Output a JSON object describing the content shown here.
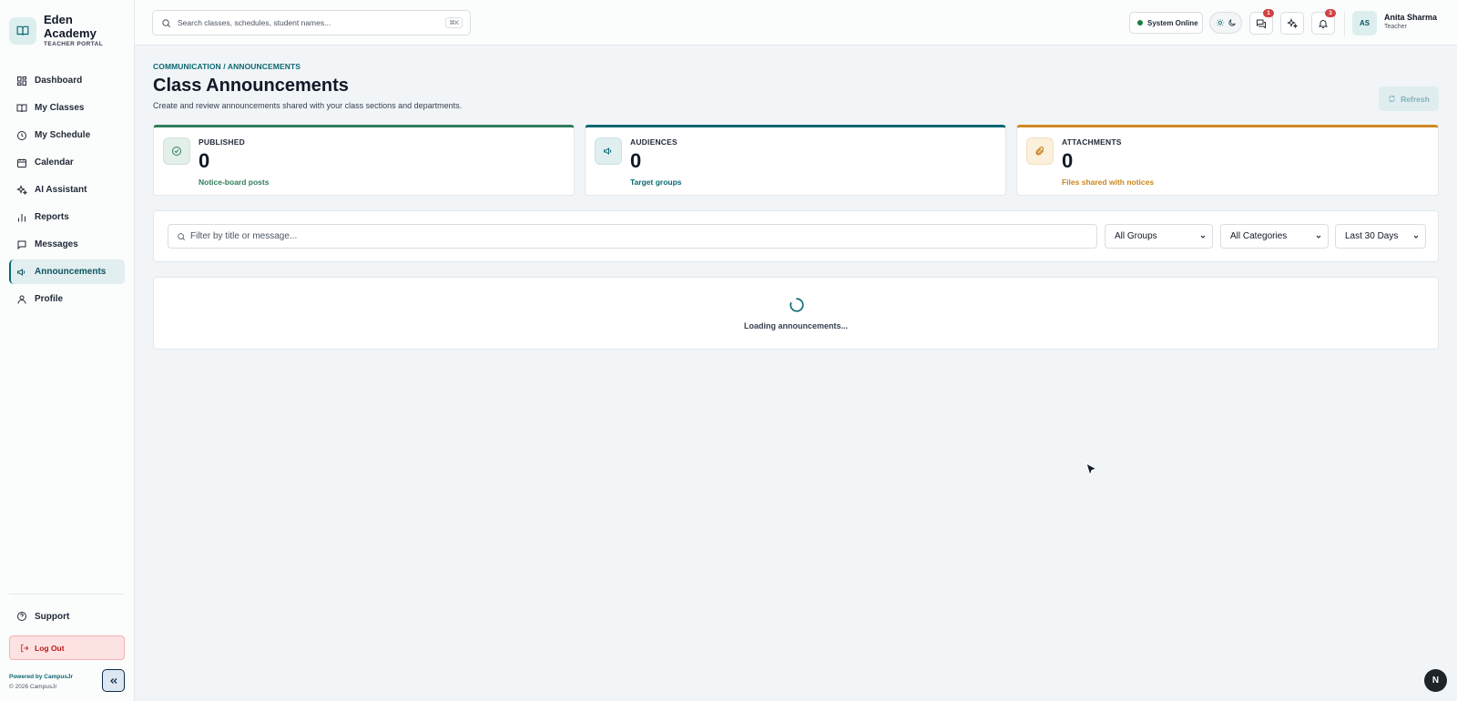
{
  "brand": {
    "name": "Eden Academy",
    "subtitle": "TEACHER PORTAL"
  },
  "sidebar": {
    "items": [
      {
        "label": "Dashboard",
        "icon": "dashboard-icon"
      },
      {
        "label": "My Classes",
        "icon": "book-icon"
      },
      {
        "label": "My Schedule",
        "icon": "clock-icon"
      },
      {
        "label": "Calendar",
        "icon": "calendar-icon"
      },
      {
        "label": "AI Assistant",
        "icon": "sparkles-icon"
      },
      {
        "label": "Reports",
        "icon": "bar-chart-icon"
      },
      {
        "label": "Messages",
        "icon": "message-icon"
      },
      {
        "label": "Announcements",
        "icon": "megaphone-icon",
        "active": true
      },
      {
        "label": "Profile",
        "icon": "user-icon"
      }
    ],
    "support_label": "Support",
    "logout_label": "Log Out",
    "powered_by": "Powered by CampusJr",
    "copyright": "© 2026 CampusJr"
  },
  "topbar": {
    "search_placeholder": "Search classes, schedules, student names...",
    "search_shortcut": "⌘K",
    "status": "System Online",
    "messages_badge": "1",
    "notifications_badge": "3",
    "user": {
      "initials": "AS",
      "name": "Anita Sharma",
      "role": "Teacher"
    }
  },
  "page": {
    "breadcrumb": "COMMUNICATION / ANNOUNCEMENTS",
    "title": "Class Announcements",
    "description": "Create and review announcements shared with your class sections and departments.",
    "refresh_label": "Refresh"
  },
  "stats": [
    {
      "label": "PUBLISHED",
      "value": "0",
      "sub": "Notice-board posts",
      "color": "#2f7d5b",
      "icon": "check-circle-icon"
    },
    {
      "label": "AUDIENCES",
      "value": "0",
      "sub": "Target groups",
      "color": "#0c6873",
      "icon": "megaphone-icon"
    },
    {
      "label": "ATTACHMENTS",
      "value": "0",
      "sub": "Files shared with notices",
      "color": "#d08a24",
      "icon": "paperclip-icon"
    }
  ],
  "filters": {
    "search_placeholder": "Filter by title or message...",
    "group": "All Groups",
    "category": "All Categories",
    "range": "Last 30 Days"
  },
  "loading": {
    "text": "Loading announcements..."
  },
  "fab_label": "N",
  "colors": {
    "accent": "#0c6873",
    "background": "#f1f5f7",
    "danger": "#b91c1c"
  }
}
